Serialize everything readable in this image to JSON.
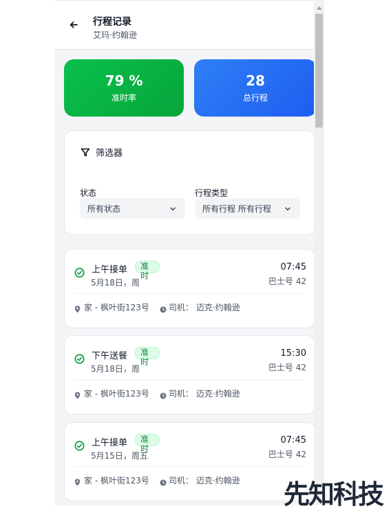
{
  "header": {
    "title": "行程记录",
    "subtitle": "艾玛·约翰逊"
  },
  "stats": [
    {
      "value": "79 %",
      "label": "准时率",
      "color": "#08c04b"
    },
    {
      "value": "28",
      "label": "总行程",
      "color": "#2f7ff6"
    }
  ],
  "filter": {
    "title": "筛选器",
    "status_label": "状态",
    "status_value": "所有状态",
    "type_label": "行程类型",
    "type_value": "所有行程 所有行程"
  },
  "trips": [
    {
      "title": "上午接单",
      "badge": "准时",
      "date": "5月18日，周",
      "time": "07:45",
      "bus": "巴士号 42",
      "location": "家 - 枫叶街123号",
      "driver": "司机： 迈克·约翰逊"
    },
    {
      "title": "下午送餐",
      "badge": "准时",
      "date": "5月18日，周",
      "time": "15:30",
      "bus": "巴士号 42",
      "location": "家 - 枫叶街123号",
      "driver": "司机： 迈克·约翰逊"
    },
    {
      "title": "上午接单",
      "badge": "准时",
      "date": "5月15日，周五",
      "time": "07:45",
      "bus": "巴士号 42",
      "location": "家 - 枫叶街123号",
      "driver": "司机： 迈克·约翰逊"
    }
  ],
  "watermark": "先知科技",
  "colors": {
    "accent_green": "#16a34a",
    "accent_blue": "#1d5ef0",
    "badge_bg": "#dcfce7"
  }
}
